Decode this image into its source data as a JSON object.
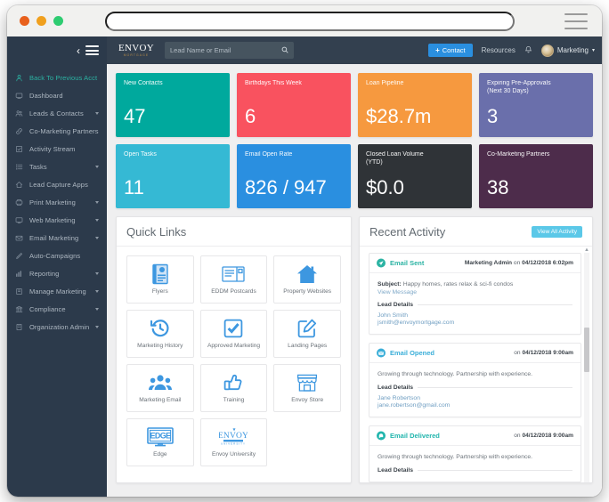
{
  "browser": {
    "url_value": "",
    "url_placeholder": "",
    "menu_icon": "hamburger-icon",
    "traffic_lights": [
      "close",
      "minimize",
      "maximize"
    ]
  },
  "topbar": {
    "collapse_chevron": "‹",
    "menu_icon": "hamburger-icon",
    "brand": {
      "main": "ENVOY",
      "sub": "MORTGAGE"
    },
    "search": {
      "value": "",
      "placeholder": "Lead Name or Email",
      "icon": "search-icon"
    },
    "contact_button": {
      "label": "Contact",
      "plus": "+",
      "color": "#2a8fe0"
    },
    "resources_label": "Resources",
    "bell_icon": "bell-icon",
    "user": {
      "name": "Marketing",
      "caret": "▾",
      "avatar": "user-avatar"
    }
  },
  "sidebar": {
    "items": [
      {
        "label": "Back To Previous Acct",
        "icon": "person-icon",
        "caret": false,
        "active": true
      },
      {
        "label": "Dashboard",
        "icon": "monitor-icon",
        "caret": false,
        "active": false
      },
      {
        "label": "Leads & Contacts",
        "icon": "people-icon",
        "caret": true,
        "active": false
      },
      {
        "label": "Co-Marketing Partners",
        "icon": "link-icon",
        "caret": false,
        "active": false
      },
      {
        "label": "Activity Stream",
        "icon": "checkbox-icon",
        "caret": false,
        "active": false
      },
      {
        "label": "Tasks",
        "icon": "list-icon",
        "caret": true,
        "active": false
      },
      {
        "label": "Lead Capture Apps",
        "icon": "home-icon",
        "caret": false,
        "active": false
      },
      {
        "label": "Print Marketing",
        "icon": "printer-icon",
        "caret": true,
        "active": false
      },
      {
        "label": "Web Marketing",
        "icon": "desktop-icon",
        "caret": true,
        "active": false
      },
      {
        "label": "Email Marketing",
        "icon": "envelope-icon",
        "caret": true,
        "active": false
      },
      {
        "label": "Auto-Campaigns",
        "icon": "pencil-icon",
        "caret": false,
        "active": false
      },
      {
        "label": "Reporting",
        "icon": "bar-chart-icon",
        "caret": true,
        "active": false
      },
      {
        "label": "Manage Marketing",
        "icon": "book-icon",
        "caret": true,
        "active": false
      },
      {
        "label": "Compliance",
        "icon": "bank-icon",
        "caret": true,
        "active": false
      },
      {
        "label": "Organization Admin",
        "icon": "building-icon",
        "caret": true,
        "active": false
      }
    ]
  },
  "kpis": [
    {
      "title": "New Contacts",
      "value": "47",
      "color": "#00a99d"
    },
    {
      "title": "Birthdays This Week",
      "value": "6",
      "color": "#f9525f"
    },
    {
      "title": "Loan Pipeline",
      "value": "$28.7m",
      "color": "#f6993f"
    },
    {
      "title": "Expiring Pre-Approvals\n(Next 30 Days)",
      "value": "3",
      "color": "#6a6fab"
    },
    {
      "title": "Open Tasks",
      "value": "11",
      "color": "#35b9d4"
    },
    {
      "title": "Email Open Rate",
      "value": "826 / 947",
      "color": "#2a8fe0"
    },
    {
      "title": "Closed Loan Volume\n(YTD)",
      "value": "$0.0",
      "color": "#2f3337"
    },
    {
      "title": "Co-Marketing Partners",
      "value": "38",
      "color": "#4d2c4b"
    }
  ],
  "quick_links": {
    "title": "Quick Links",
    "tiles": [
      {
        "label": "Flyers",
        "icon": "flyer-icon"
      },
      {
        "label": "EDDM Postcards",
        "icon": "postcard-icon"
      },
      {
        "label": "Property Websites",
        "icon": "home-icon"
      },
      {
        "label": "Marketing History",
        "icon": "history-clock-icon"
      },
      {
        "label": "Approved Marketing",
        "icon": "check-square-icon"
      },
      {
        "label": "Landing Pages",
        "icon": "pencil-square-icon"
      },
      {
        "label": "Marketing Email",
        "icon": "group-people-icon"
      },
      {
        "label": "Training",
        "icon": "thumbs-up-icon"
      },
      {
        "label": "Envoy Store",
        "icon": "storefront-icon"
      },
      {
        "label": "Edge",
        "icon": "edge-logo-icon"
      },
      {
        "label": "Envoy University",
        "icon": "envoy-logo-icon"
      }
    ]
  },
  "recent_activity": {
    "title": "Recent Activity",
    "view_all_label": "View All Activity",
    "scroll_up_icon": "scroll-up-icon",
    "items": [
      {
        "type": "Email Sent",
        "icon": "paper-plane-icon",
        "icon_color": "#2bb3a3",
        "actor": "Marketing Admin",
        "meta_prefix": "on",
        "timestamp": "04/12/2018 6:02pm",
        "subject_label": "Subject:",
        "subject": "Happy homes, rates relax & sci-fi condos",
        "message_link": "View Message",
        "lead_details_label": "Lead Details",
        "lead_name": "John Smith",
        "lead_email": "jsmith@envoymortgage.com"
      },
      {
        "type": "Email Opened",
        "icon": "open-envelope-icon",
        "icon_color": "#3aaed8",
        "actor": "",
        "meta_prefix": "on",
        "timestamp": "04/12/2018 9:00am",
        "subject_label": "",
        "subject": "Growing through technology. Partnership with experience.",
        "message_link": "",
        "lead_details_label": "Lead Details",
        "lead_name": "Jane Robertson",
        "lead_email": "jane.robertson@gmail.com"
      },
      {
        "type": "Email Delivered",
        "icon": "delivered-icon",
        "icon_color": "#21b5ad",
        "actor": "",
        "meta_prefix": "on",
        "timestamp": "04/12/2018 9:00am",
        "subject_label": "",
        "subject": "Growing through technology. Partnership with experience.",
        "message_link": "",
        "lead_details_label": "Lead Details",
        "lead_name": "",
        "lead_email": ""
      }
    ]
  }
}
